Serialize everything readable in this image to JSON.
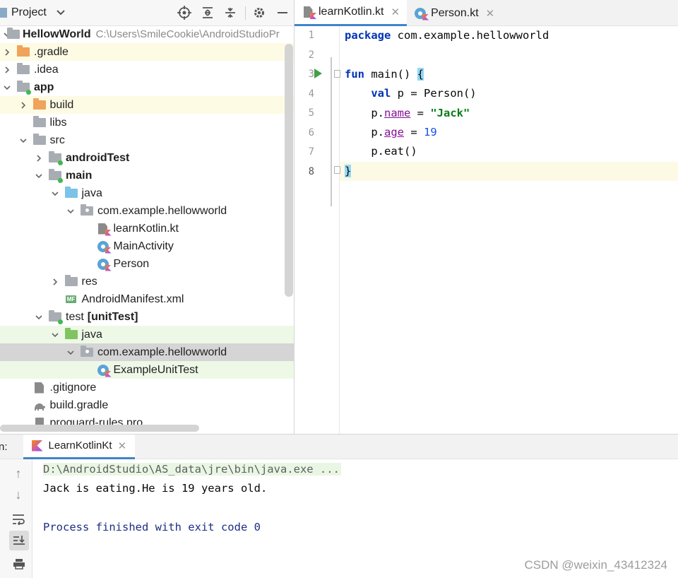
{
  "project_panel": {
    "title": "Project",
    "toolbar_icons": [
      "locate-icon",
      "expand-all-icon",
      "collapse-all-icon",
      "gear-icon",
      "minimize-icon"
    ],
    "root": {
      "name": "HellowWorld",
      "path": "C:\\Users\\SmileCookie\\AndroidStudioPr"
    },
    "tree": [
      {
        "label": ".gradle",
        "icon": "folder-orange",
        "level": 1,
        "chev": "right",
        "bold": false,
        "hl": "yellow"
      },
      {
        "label": ".idea",
        "icon": "folder-grey",
        "level": 1,
        "chev": "right",
        "bold": false,
        "hl": ""
      },
      {
        "label": "app",
        "icon": "folder-module",
        "level": 1,
        "chev": "down",
        "bold": true,
        "hl": ""
      },
      {
        "label": "build",
        "icon": "folder-orange",
        "level": 2,
        "chev": "right",
        "bold": false,
        "hl": "yellow"
      },
      {
        "label": "libs",
        "icon": "folder-grey",
        "level": 2,
        "chev": "",
        "bold": false,
        "hl": ""
      },
      {
        "label": "src",
        "icon": "folder-grey",
        "level": 2,
        "chev": "down",
        "bold": false,
        "hl": ""
      },
      {
        "label": "androidTest",
        "icon": "folder-module",
        "level": 3,
        "chev": "right",
        "bold": true,
        "hl": ""
      },
      {
        "label": "main",
        "icon": "folder-module",
        "level": 3,
        "chev": "down",
        "bold": true,
        "hl": ""
      },
      {
        "label": "java",
        "icon": "folder-blue",
        "level": 4,
        "chev": "down",
        "bold": false,
        "hl": ""
      },
      {
        "label": "com.example.hellowworld",
        "icon": "package",
        "level": 5,
        "chev": "down",
        "bold": false,
        "hl": ""
      },
      {
        "label": "learnKotlin.kt",
        "icon": "kotlin-file",
        "level": 6,
        "chev": "",
        "bold": false,
        "hl": ""
      },
      {
        "label": "MainActivity",
        "icon": "kotlin-class",
        "level": 6,
        "chev": "",
        "bold": false,
        "hl": ""
      },
      {
        "label": "Person",
        "icon": "kotlin-class",
        "level": 6,
        "chev": "",
        "bold": false,
        "hl": ""
      },
      {
        "label": "res",
        "icon": "folder-res",
        "level": 4,
        "chev": "right",
        "bold": false,
        "hl": ""
      },
      {
        "label": "AndroidManifest.xml",
        "icon": "manifest",
        "level": 4,
        "chev": "",
        "bold": false,
        "hl": ""
      },
      {
        "label": "test",
        "suffix": "[unitTest]",
        "icon": "folder-module",
        "level": 3,
        "chev": "down",
        "bold": false,
        "hl": ""
      },
      {
        "label": "java",
        "icon": "folder-green",
        "level": 4,
        "chev": "down",
        "bold": false,
        "hl": "green"
      },
      {
        "label": "com.example.hellowworld",
        "icon": "package",
        "level": 5,
        "chev": "down",
        "bold": false,
        "hl": "grey"
      },
      {
        "label": "ExampleUnitTest",
        "icon": "kotlin-class",
        "level": 6,
        "chev": "",
        "bold": false,
        "hl": "green"
      },
      {
        "label": ".gitignore",
        "icon": "file",
        "level": 2,
        "chev": "",
        "bold": false,
        "hl": ""
      },
      {
        "label": "build.gradle",
        "icon": "gradle",
        "level": 2,
        "chev": "",
        "bold": false,
        "hl": ""
      },
      {
        "label": "proguard-rules.pro",
        "icon": "text-file",
        "level": 2,
        "chev": "",
        "bold": false,
        "hl": ""
      }
    ]
  },
  "editor": {
    "tabs": [
      {
        "label": "learnKotlin.kt",
        "icon": "kotlin-file",
        "active": true
      },
      {
        "label": "Person.kt",
        "icon": "kotlin-class",
        "active": false
      }
    ],
    "line_numbers": [
      "1",
      "2",
      "3",
      "4",
      "5",
      "6",
      "7",
      "8"
    ],
    "current_line": 8,
    "code": [
      [
        {
          "t": "package",
          "c": "kw"
        },
        {
          "t": " com.example.hellowworld",
          "c": ""
        }
      ],
      [],
      [
        {
          "t": "fun",
          "c": "kw"
        },
        {
          "t": " main() ",
          "c": ""
        },
        {
          "t": "{",
          "c": "brace-hl"
        }
      ],
      [
        {
          "t": "    ",
          "c": ""
        },
        {
          "t": "val",
          "c": "kw"
        },
        {
          "t": " p = Person()",
          "c": ""
        }
      ],
      [
        {
          "t": "    p.",
          "c": ""
        },
        {
          "t": "name",
          "c": "prop"
        },
        {
          "t": " = ",
          "c": ""
        },
        {
          "t": "\"Jack\"",
          "c": "str"
        }
      ],
      [
        {
          "t": "    p.",
          "c": ""
        },
        {
          "t": "age",
          "c": "prop"
        },
        {
          "t": " = ",
          "c": ""
        },
        {
          "t": "19",
          "c": "num"
        }
      ],
      [
        {
          "t": "    p.eat()",
          "c": ""
        }
      ],
      [
        {
          "t": "}",
          "c": "brace-hl"
        }
      ]
    ]
  },
  "run_panel": {
    "label": "n:",
    "tab": "LearnKotlinKt",
    "side_icons": [
      "arrow-up-icon",
      "arrow-down-icon",
      "soft-wrap-icon",
      "scroll-to-end-icon",
      "print-icon"
    ],
    "console": [
      {
        "text": "D:\\AndroidStudio\\AS_data\\jre\\bin\\java.exe ...",
        "kind": "cmd"
      },
      {
        "text": "Jack is eating.He is 19 years old.",
        "kind": "out"
      },
      {
        "text": "",
        "kind": "out"
      },
      {
        "text": "Process finished with exit code 0",
        "kind": "exit"
      }
    ]
  },
  "watermark": "CSDN @weixin_43412324",
  "colors": {
    "keyword": "#0033b3",
    "string": "#067d17",
    "number": "#1750eb",
    "property": "#871094",
    "folder_orange": "#f0a35b",
    "folder_grey": "#a8adb3",
    "folder_blue": "#7cc3e8",
    "folder_green": "#7fc461",
    "accent": "#4083c9"
  }
}
